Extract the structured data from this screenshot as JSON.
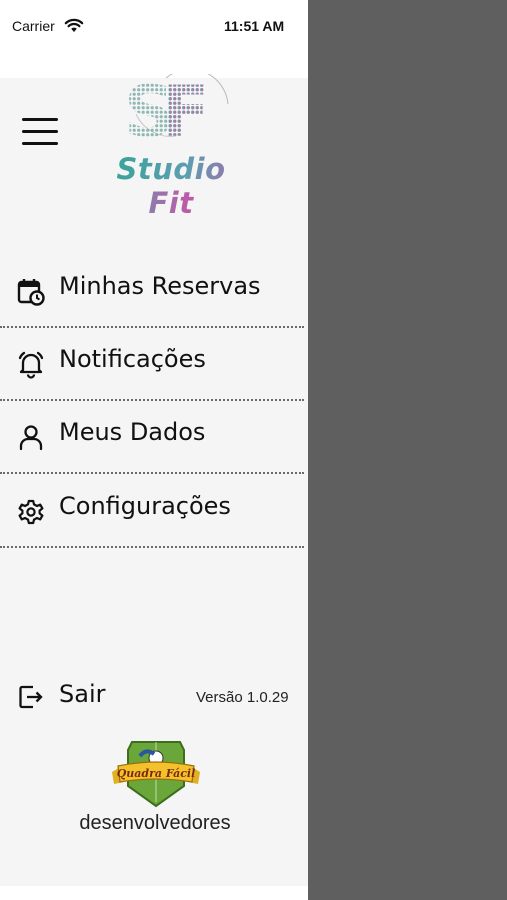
{
  "status_bar": {
    "carrier": "Carrier",
    "time": "11:51 AM"
  },
  "brand": {
    "name": "Studio Fit",
    "monogram": "SF",
    "text_color_start": "#3aa39a",
    "text_color_end": "#c455a7"
  },
  "menu": {
    "items": [
      {
        "label": "Minhas Reservas",
        "icon": "calendar-clock-icon"
      },
      {
        "label": "Notificações",
        "icon": "bell-icon"
      },
      {
        "label": "Meus Dados",
        "icon": "user-icon"
      },
      {
        "label": "Configurações",
        "icon": "gear-icon"
      }
    ]
  },
  "footer": {
    "logout_label": "Sair",
    "version": "Versão 1.0.29",
    "developer_badge": "Quadra Fácil",
    "developer_caption": "desenvolvedores"
  },
  "colors": {
    "overlay": "#5f5f5f",
    "drawer_bg": "#f5f5f5"
  }
}
